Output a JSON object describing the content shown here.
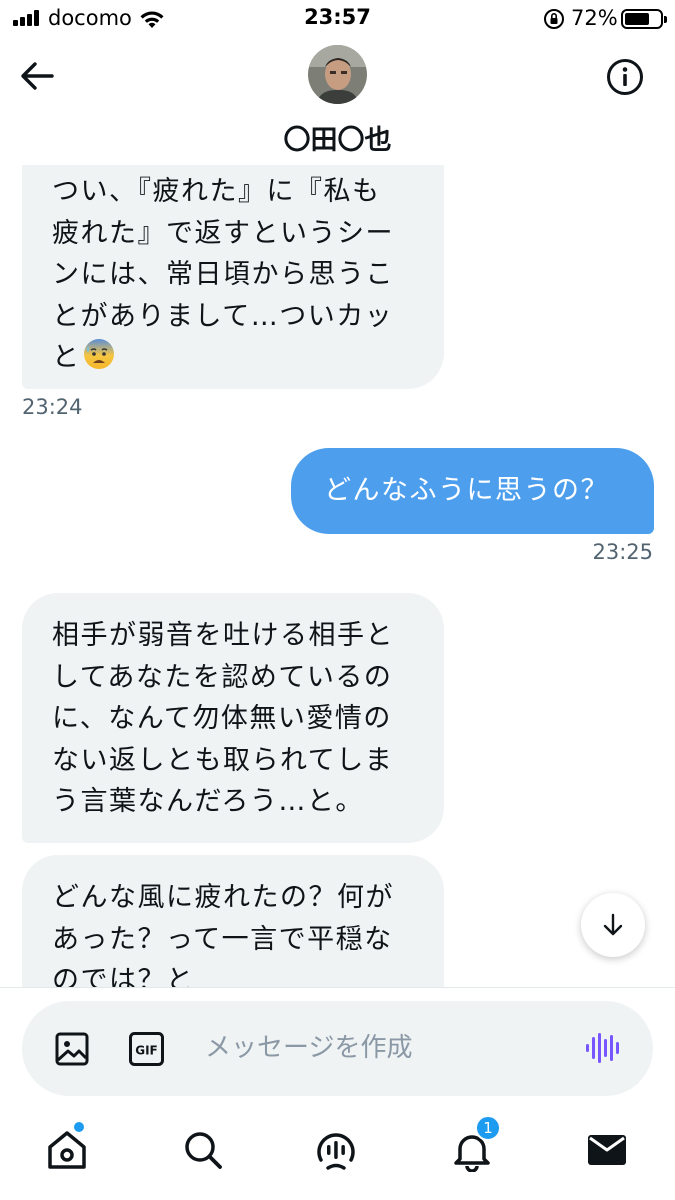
{
  "status_bar": {
    "carrier": "docomo",
    "time": "23:57",
    "battery": "72%",
    "battery_level": 0.72
  },
  "header": {
    "title": "〇田〇也",
    "icons": [
      "back-arrow-icon",
      "avatar",
      "info-icon"
    ]
  },
  "messages": [
    {
      "direction": "in",
      "text": "つい、『疲れた』に『私も\n疲れた』で返すというシー\nンには、常日頃から思うこ\nとがありまして…ついカッ\nと",
      "emoji": "anxious-face-with-sweat",
      "time": "23:24"
    },
    {
      "direction": "out",
      "text": "どんなふうに思うの？",
      "time": "23:25"
    },
    {
      "direction": "in",
      "text": "相手が弱音を吐ける相手と\nしてあなたを認めているの\nに、なんて勿体無い愛情の\nない返しとも取られてしま\nう言葉なんだろう…と。"
    },
    {
      "direction": "in",
      "text": "どんな風に疲れたの？何が\nあった？って一言で平穏な\nのでは？と"
    }
  ],
  "composer": {
    "placeholder": "メッセージを作成",
    "value": "",
    "gif_label": "GIF"
  },
  "tabbar": {
    "items": [
      "home-icon",
      "search-icon",
      "spaces-icon",
      "notifications-icon",
      "messages-icon"
    ],
    "notification_count": "1"
  },
  "colors": {
    "accent": "#1d9bf0",
    "outgoing_bubble": "#4d9fee",
    "incoming_bubble": "#eff3f4",
    "timestamp": "#536471",
    "voice": "#7856ff"
  }
}
